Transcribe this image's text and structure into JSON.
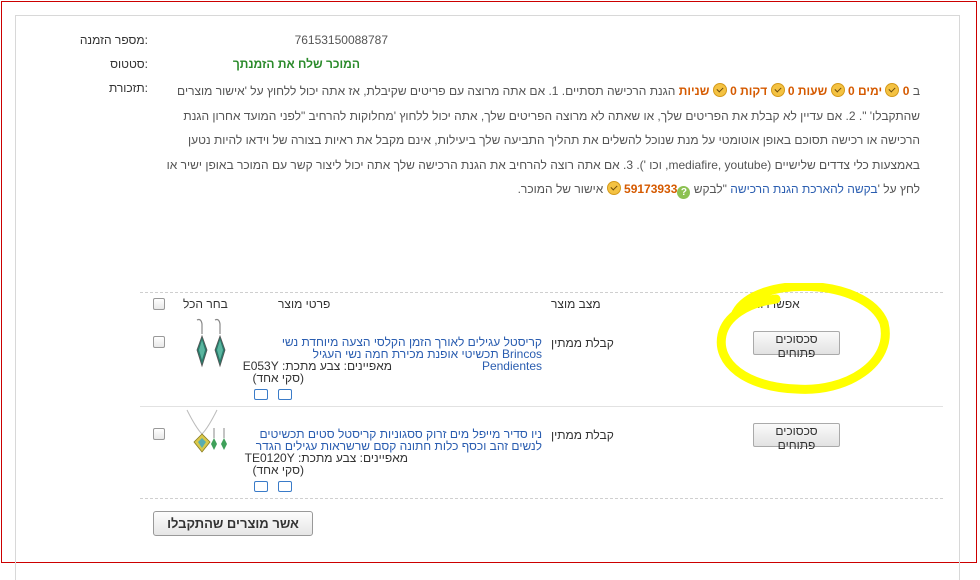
{
  "order": {
    "number_label": "מספר הזמנה:",
    "number": "76153150088787",
    "status_label": "סטטוס:",
    "status": "המוכר שלח את הזמנתך",
    "reminder_label": "תזכורת:"
  },
  "reminder": {
    "prefix": "ב",
    "countdown": [
      {
        "value": "0",
        "unit": "ימים"
      },
      {
        "value": "0",
        "unit": "שעות"
      },
      {
        "value": "0",
        "unit": "דקות"
      },
      {
        "value": "0",
        "unit": "שניות"
      }
    ],
    "text1": "הגנת הרכישה תסתיים. 1. אם אתה מרוצה עם פריטים שקיבלת, אז אתה יכול ללחוץ על 'אישור מוצרים שהתקבלו' \". 2. אם עדיין לא קבלת את הפריטים שלך, או שאתה לא מרוצה הפריטים שלך, אתה יכול ללחוץ 'מחלוקות להרחיב \"לפני המועד אחרון הגנת הרכישה או רכישה תסוכם באופן אוטומטי על מנת שנוכל להשלים את תהליך התביעה שלך ביעילות, אינם מקבל את ראיות בצורה של וידאו להיות נטען באמצעות כלי צדדים שלישיים (mediafire, youtube, וכו '). 3. אם אתה רוצה להרחיב את הגנת הרכישה שלך אתה יכול ליצור קשר עם המוכר באופן ישיר או לחץ על '",
    "link": "בקשה להארכת הגנת הרכישה",
    "text2": "\"לבקש",
    "points": "59173933",
    "text3": "אישור של המוכר."
  },
  "table": {
    "headers": {
      "select_all": "בחר הכל",
      "details": "פרטי מוצר",
      "state": "מצב מוצר",
      "options": "אפשרויות"
    },
    "rows": [
      {
        "title": "קריסטל עגילים לאורך הזמן הקלסי הצעה מיוחדת נשי Brincos תכשיטי אופנת מכירת חמה נשי העגיל Pendientes",
        "attr": "מאפיינים: צבע מתכת: E053Y",
        "qty": "(סקי אחד)",
        "state": "קבלת ממתין",
        "button": "סכסוכים פתוחים"
      },
      {
        "title": "ניו סדיר מייפל מים זרוק ססגוניות קריסטל סטים תכשיטים לנשים זהב וכסף כלות חתונה קסם שרשראות עגילים הגדר",
        "attr": "מאפיינים: צבע מתכת: TE0120Y",
        "qty": "(סקי אחד)",
        "state": "קבלת ממתין",
        "button": "סכסוכים פתוחים"
      }
    ]
  },
  "confirm_button": "אשר מוצרים שהתקבלו",
  "colors": {
    "status_green": "#2a8a2a",
    "countdown_orange": "#d55a00",
    "link_blue": "#2a5db0",
    "highlight_yellow": "#ffff00",
    "frame_red": "#cc0000"
  }
}
